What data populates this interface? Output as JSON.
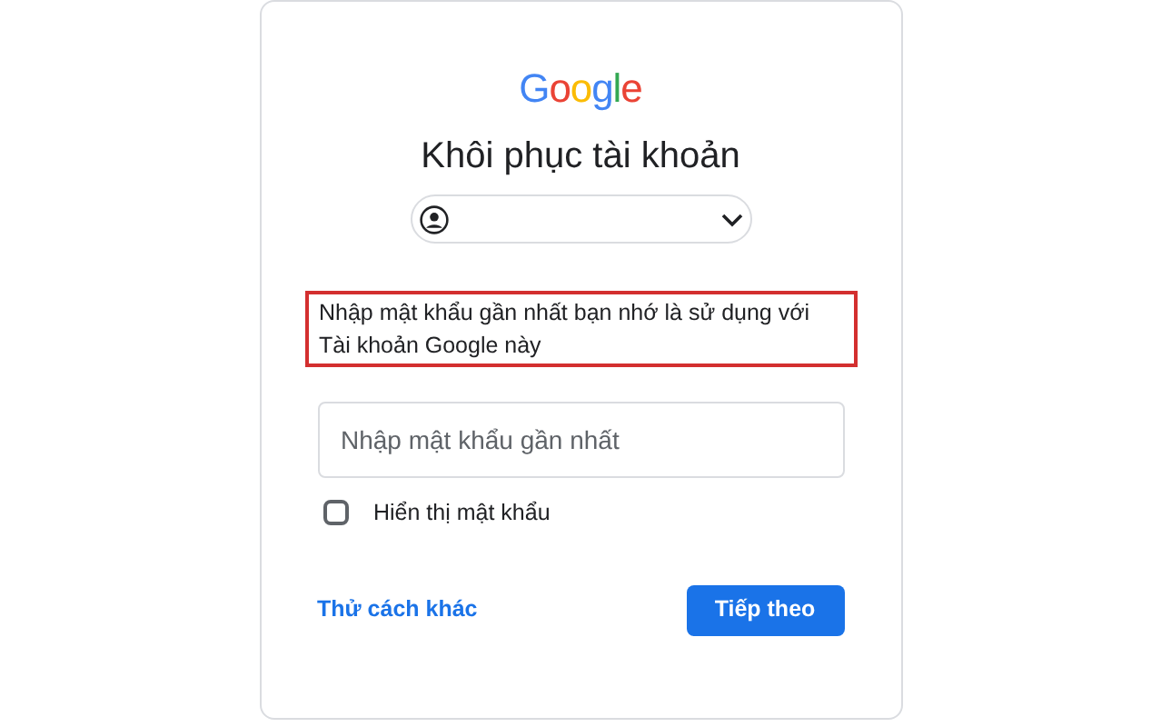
{
  "logo": {
    "text": "Google"
  },
  "title": "Khôi phục tài khoản",
  "account_chip": {
    "expanded": false
  },
  "note": {
    "text": "Nhập mật khẩu gần nhất bạn nhớ là sử dụng với Tài khoản Google này",
    "highlighted": true
  },
  "password_field": {
    "placeholder": "Nhập mật khẩu gần nhất"
  },
  "show_password": {
    "label": "Hiển thị mật khẩu",
    "checked": false
  },
  "try_another_link": "Thử cách khác",
  "next_button": "Tiếp theo"
}
